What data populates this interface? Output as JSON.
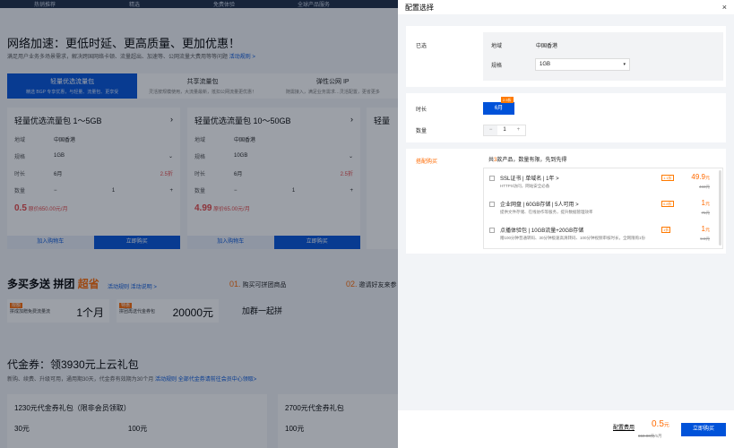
{
  "colors": {
    "accent": "#0052d9",
    "orange": "#ff6a00",
    "overlay": "rgba(20,28,46,0.42)"
  },
  "background": {
    "nav": [
      "热销推荐",
      "精选",
      "免费体验",
      "全球产品服务"
    ],
    "hero_title": "网络加速：更低时延、更高质量、更加优惠！",
    "hero_desc": "满足用户业务多场景需求，解决跨国网络卡顿、流量超出、加速等、公网流量大费用等等问题",
    "hero_link": "活动规则 >",
    "tabs": [
      {
        "title": "轻量优选流量包",
        "desc": "精选 BGP 专享优惠，与轻量、流量包、更享受"
      },
      {
        "title": "共享流量包",
        "desc": "灵活按规模使用，大流量最新，抵扣公网流量更优惠！"
      },
      {
        "title": "弹性公网 IP",
        "desc": "随需接入，满足业务需求…灵活配置，更省更多"
      }
    ],
    "cards": [
      {
        "title": "轻量优选流量包 1～5GB",
        "region": "中国香港",
        "spec": "1GB",
        "duration": "6月",
        "qty": "1",
        "price": "0.5",
        "old": "原价650.00元/月",
        "add": "加入购物车",
        "buy": "立即购买"
      },
      {
        "title": "轻量优选流量包 10～50GB",
        "region": "中国香港",
        "spec": "10GB",
        "duration": "6月",
        "qty": "1",
        "price": "4.99",
        "old": "原价65.00元/月",
        "add": "加入购物车",
        "buy": "立即购买"
      },
      {
        "title": "轻量"
      }
    ],
    "card_labels": {
      "region": "地域",
      "spec": "规格",
      "duration": "时长",
      "qty": "数量",
      "badge": "2.5折",
      "hot": "限时"
    },
    "promo_title_a": "多买多送 拼团",
    "promo_title_b": "超省",
    "promo_link": "活动规则 活动说明 >",
    "step1": "购买可拼团商品",
    "step1_n": "01.",
    "step2": "邀请好友来参",
    "step2_n": "02.",
    "promo_boxes": [
      {
        "tag": "限额",
        "text": "拼成加赠免费流量流",
        "big": "1个月"
      },
      {
        "tag": "特惠",
        "text": "拼团再送代金券包",
        "big": "20000元"
      }
    ],
    "group_buy": "加群一起拼",
    "coupon_title": "代金券：领3930元上云礼包",
    "coupon_desc": "新购、续费、升级可用，通用期30天，代金券有效期为30个月",
    "coupon_link": "活动规则  全部代金券请前往会员中心领取>",
    "coupons": [
      {
        "title": "1230元代金券礼包（限非会员领取）",
        "v1": "30元",
        "v2": "100元"
      },
      {
        "title": "2700元代金券礼包",
        "v1": "100元",
        "v2": ""
      }
    ]
  },
  "panel": {
    "title": "配置选择",
    "close": "×",
    "chosen_label": "已选",
    "region_label": "地域",
    "region_value": "中国香港",
    "spec_label": "规格",
    "spec_value": "1GB",
    "duration_label": "时长",
    "duration_value": "6月",
    "duration_badge": "2.5折",
    "qty_label": "数量",
    "qty_value": "1",
    "qty_minus": "−",
    "qty_plus": "+",
    "bundle_label": "搭配购买",
    "bundle_prefix": "共",
    "bundle_num": "3",
    "bundle_suffix": "款产品，数量有限，先到先得",
    "items": [
      {
        "name": "SSL证书 | 单域名 | 1年 >",
        "desc": "HTTPS访问，网站安全必备",
        "disc": "1.1折",
        "price": "49.9",
        "unit": "元",
        "old": "468元"
      },
      {
        "name": "企业网盘 | 60GB存储 | 5人可用 >",
        "desc": "提供文件存储、在线协作等服务，提升数据管理效率",
        "disc": "0.8折",
        "price": "1",
        "unit": "元",
        "old": "75元"
      },
      {
        "name": "点播体验包 | 10GB流量+20GB存储",
        "desc": "赠100分钟普通转码、30分钟极速高清转码、100分钟视频审核时长，全网限购1份",
        "disc": "1折",
        "price": "1",
        "unit": "元",
        "old": "9.9元"
      }
    ],
    "footer_label": "配置费用",
    "footer_price": "0.5",
    "footer_unit": "元",
    "footer_old": "650.00元",
    "footer_save": "/6月",
    "buy": "立即购买"
  }
}
